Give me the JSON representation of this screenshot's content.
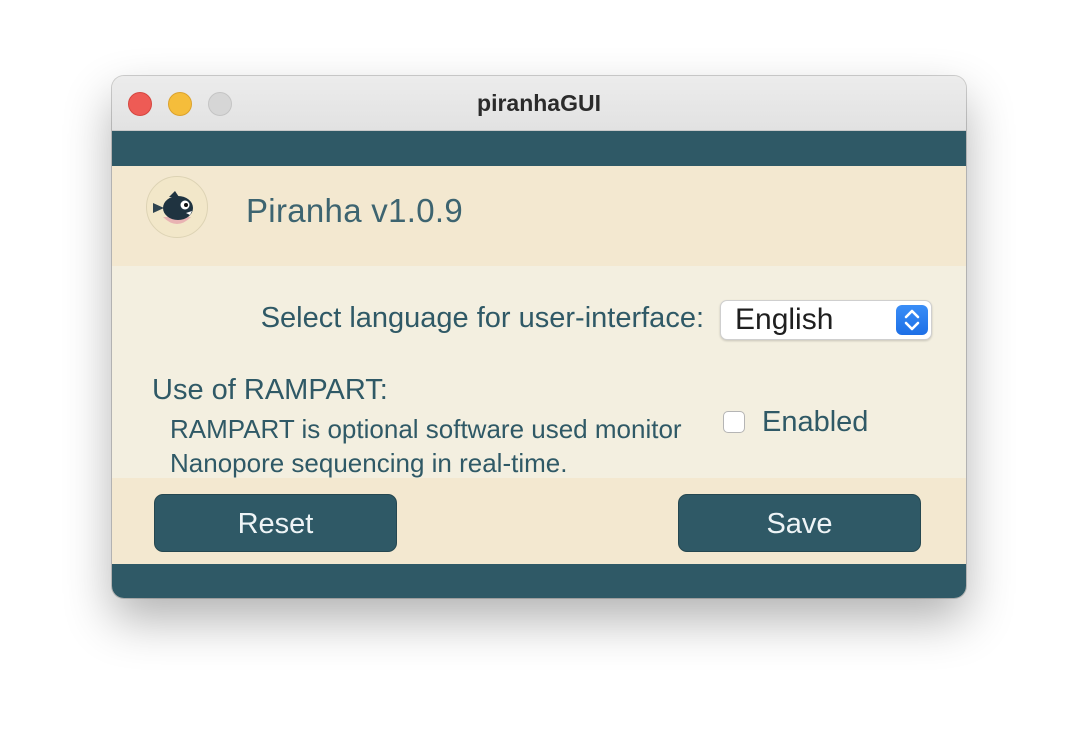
{
  "window": {
    "title": "piranhaGUI"
  },
  "header": {
    "version": "Piranha v1.0.9"
  },
  "settings": {
    "language_label": "Select language for user-interface:",
    "language_value": "English",
    "rampart_title": "Use of RAMPART:",
    "rampart_description_line1": "RAMPART is optional software used monitor",
    "rampart_description_line2": "Nanopore sequencing in real-time.",
    "rampart_checkbox_label": "Enabled",
    "rampart_enabled": false
  },
  "buttons": {
    "reset_label": "Reset",
    "save_label": "Save"
  },
  "colors": {
    "accent": "#2f5966",
    "header_bg": "#f3e8d0",
    "content_bg": "#f3efe0"
  },
  "icons": {
    "logo": "piranha-fish-logo",
    "select_stepper": "chevron-up-down-icon"
  }
}
